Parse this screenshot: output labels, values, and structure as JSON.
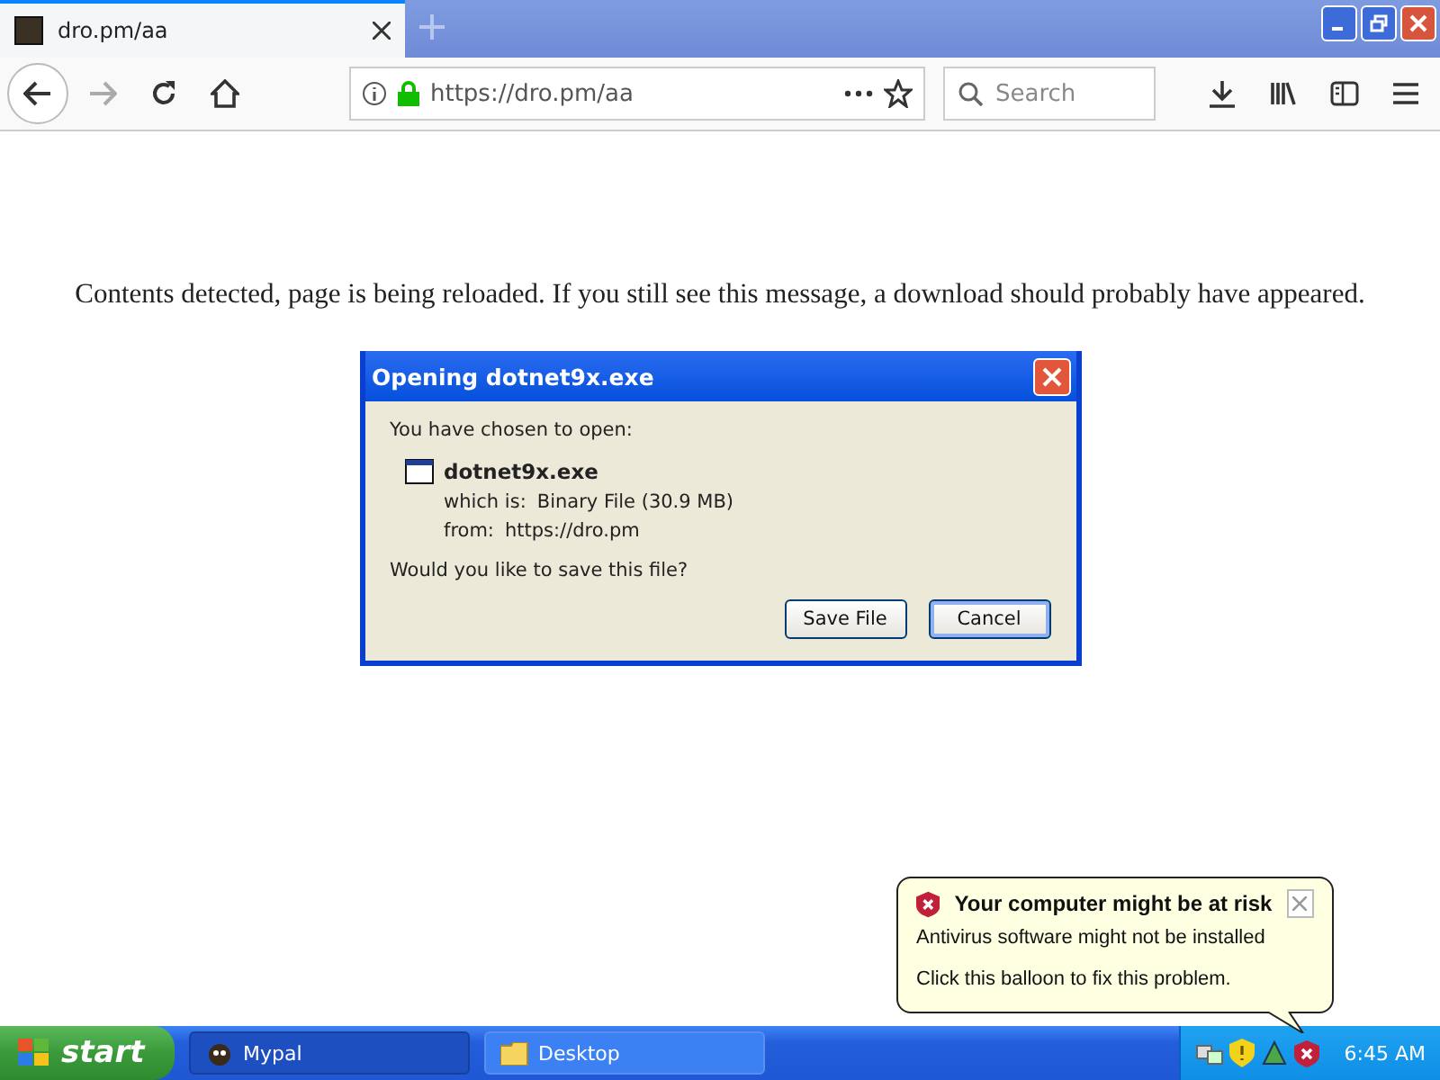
{
  "browser": {
    "tab": {
      "title": "dro.pm/aa"
    },
    "url": "https://dro.pm/aa",
    "search": {
      "placeholder": "Search"
    }
  },
  "page": {
    "message": "Contents detected, page is being reloaded. If you still see this message, a download should probably have appeared."
  },
  "dialog": {
    "title": "Opening dotnet9x.exe",
    "intro": "You have chosen to open:",
    "file_name": "dotnet9x.exe",
    "type_label": "which is:",
    "type_value": "Binary File (30.9 MB)",
    "from_label": "from:",
    "from_value": "https://dro.pm",
    "question": "Would you like to save this file?",
    "buttons": [
      {
        "label": "Save File",
        "selected": false
      },
      {
        "label": "Cancel",
        "selected": true
      }
    ]
  },
  "balloon": {
    "title": "Your computer might be at risk",
    "line_1": "Antivirus software might not be installed",
    "line_2": "Click this balloon to fix this problem."
  },
  "taskbar": {
    "start": "start",
    "tasks": [
      {
        "label": "Mypal",
        "kind": "app",
        "selected": true
      },
      {
        "label": "Desktop",
        "kind": "folder",
        "selected": false
      }
    ],
    "clock": "6:45 AM"
  }
}
